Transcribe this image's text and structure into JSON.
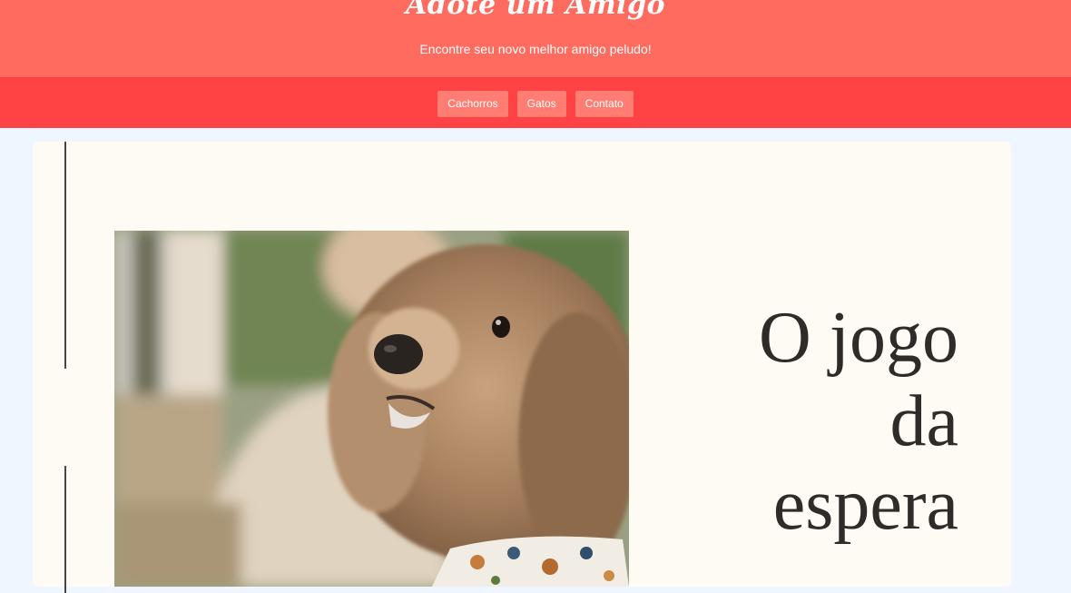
{
  "header": {
    "title": "Adote um Amigo",
    "subtitle": "Encontre seu novo melhor amigo peludo!"
  },
  "nav": {
    "items": [
      {
        "label": "Cachorros"
      },
      {
        "label": "Gatos"
      },
      {
        "label": "Contato"
      }
    ]
  },
  "banner": {
    "headline_lines": [
      "O jogo",
      "da",
      "espera"
    ]
  },
  "colors": {
    "header_bg": "#ff6b5e",
    "nav_bg": "#ff4345",
    "nav_button_bg": "#ff7d72",
    "page_bg": "#f0f6ff",
    "card_bg": "#fefaf4",
    "headline_text": "#2f2b29"
  }
}
